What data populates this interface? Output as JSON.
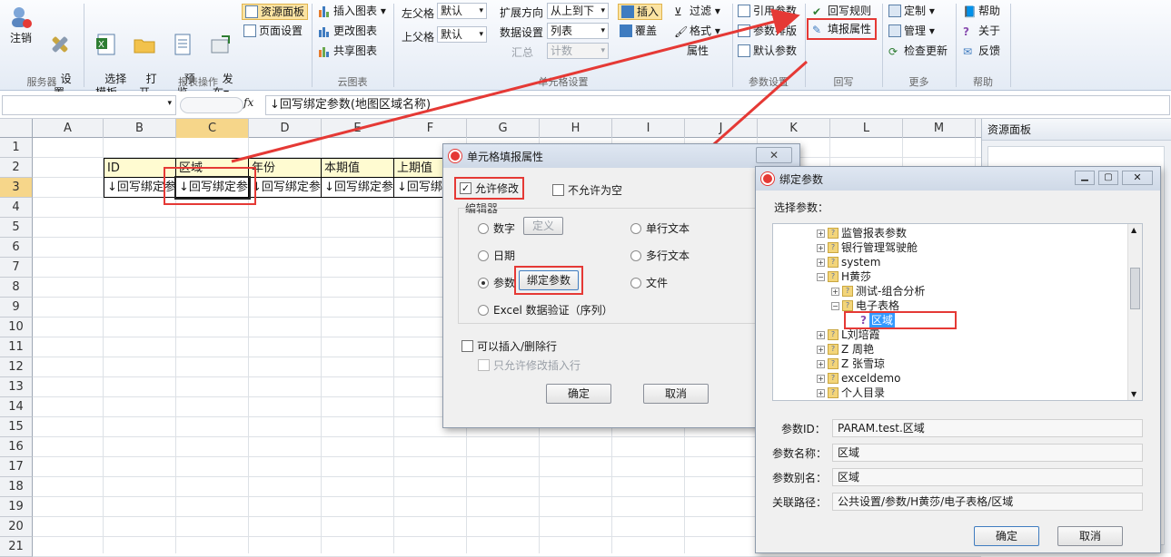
{
  "ribbon": {
    "logout": "注销",
    "settings": "设\n置",
    "group1": "服务器",
    "select_template": "选择\n模板",
    "open": "打\n开",
    "preview": "预\n览",
    "publish": "发\n布▾",
    "resource_panel": "资源面板",
    "page_setup": "页面设置",
    "group2": "报表操作",
    "insert_chart": "插入图表 ▾",
    "change_chart": "更改图表",
    "share_chart": "共享图表",
    "group3": "云图表",
    "left_parent": "左父格",
    "left_parent_val": "默认",
    "top_parent": "上父格",
    "top_parent_val": "默认",
    "expand_dir": "扩展方向",
    "expand_dir_val": "从上到下",
    "data_setting": "数据设置",
    "data_setting_val": "列表",
    "summary": "汇总",
    "summary_val": "计数",
    "group4": "单元格设置",
    "insert": "插入",
    "cover": "覆盖",
    "filter": "过滤 ▾",
    "format": "格式 ▾",
    "property": "属性",
    "ref_param": "引用参数",
    "param_layout": "参数排版",
    "default_param": "默认参数",
    "group5": "参数设置",
    "write_rule": "回写规则",
    "fill_property": "填报属性",
    "group6": "回写",
    "customize": "定制 ▾",
    "manage": "管理 ▾",
    "check_update": "检查更新",
    "group7": "更多",
    "help": "帮助",
    "about": "关于",
    "feedback": "反馈",
    "group8": "帮助"
  },
  "formula": {
    "fx": "fx",
    "content": "↓回写绑定参数(地图区域名称)"
  },
  "columns": [
    "A",
    "B",
    "C",
    "D",
    "E",
    "F",
    "G",
    "H",
    "I",
    "J",
    "K",
    "L",
    "M"
  ],
  "rows": [
    "1",
    "2",
    "3",
    "4",
    "5",
    "6",
    "7",
    "8",
    "9",
    "10",
    "11",
    "12",
    "13",
    "14",
    "15",
    "16",
    "17",
    "18",
    "19",
    "20",
    "21"
  ],
  "headers": [
    "ID",
    "区域",
    "年份",
    "本期值",
    "上期值"
  ],
  "row3": [
    "↓回写绑定参",
    "↓回写绑定参",
    "↓回写绑定参",
    "↓回写绑定参",
    "↓回写绑"
  ],
  "resource_panel_title": "资源面板",
  "dlg1": {
    "title": "单元格填报属性",
    "allow_edit": "允许修改",
    "not_null": "不允许为空",
    "editor": "编辑器",
    "number": "数字",
    "define": "定义",
    "date": "日期",
    "param": "参数",
    "bind_param": "绑定参数",
    "excel_valid": "Excel 数据验证（序列）",
    "single_text": "单行文本",
    "multi_text": "多行文本",
    "file": "文件",
    "can_insert": "可以插入/删除行",
    "only_edit_insert": "只允许修改插入行",
    "ok": "确定",
    "cancel": "取消"
  },
  "dlg2": {
    "title": "绑定参数",
    "select": "选择参数：",
    "tree": [
      "监管报表参数",
      "银行管理驾驶舱",
      "system",
      "H黄莎",
      "测试-组合分析",
      "电子表格",
      "区域",
      "L刘培霞",
      "Z 周艳",
      "Z 张雪琼",
      "exceldemo",
      "个人目录"
    ],
    "param_id_label": "参数ID：",
    "param_id": "PARAM.test.区域",
    "param_name_label": "参数名称：",
    "param_name": "区域",
    "param_alias_label": "参数别名：",
    "param_alias": "区域",
    "path_label": "关联路径：",
    "path": "公共设置/参数/H黄莎/电子表格/区域",
    "ok": "确定",
    "cancel": "取消"
  },
  "colors": {
    "accent": "#e53935",
    "selected": "#3399ff"
  }
}
